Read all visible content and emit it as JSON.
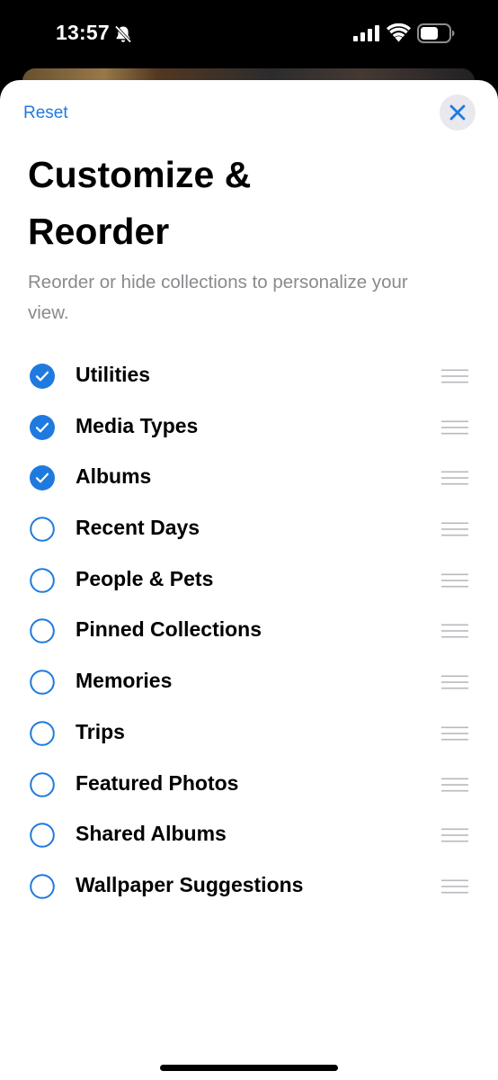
{
  "status_bar": {
    "time": "13:57",
    "icons": [
      "bell-slash-icon",
      "cellular-signal-icon",
      "wifi-icon",
      "battery-icon"
    ]
  },
  "toolbar": {
    "reset_label": "Reset",
    "close_icon": "close-icon"
  },
  "header": {
    "title_line1": "Customize &",
    "title_line2": "Reorder",
    "subtitle": "Reorder or hide collections to personalize your view."
  },
  "colors": {
    "accent": "#1f7ae0",
    "subtitle": "#8a8a8e",
    "close_bg": "#e8e8ed"
  },
  "collections": [
    {
      "label": "Utilities",
      "checked": true
    },
    {
      "label": "Media Types",
      "checked": true
    },
    {
      "label": "Albums",
      "checked": true
    },
    {
      "label": "Recent Days",
      "checked": false
    },
    {
      "label": "People & Pets",
      "checked": false
    },
    {
      "label": "Pinned Collections",
      "checked": false
    },
    {
      "label": "Memories",
      "checked": false
    },
    {
      "label": "Trips",
      "checked": false
    },
    {
      "label": "Featured Photos",
      "checked": false
    },
    {
      "label": "Shared Albums",
      "checked": false
    },
    {
      "label": "Wallpaper Suggestions",
      "checked": false
    }
  ]
}
